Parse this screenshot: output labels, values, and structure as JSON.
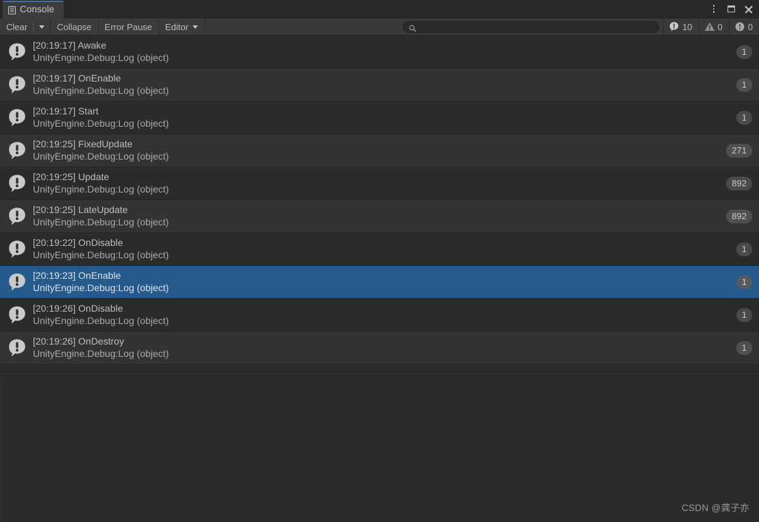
{
  "window": {
    "tab_label": "Console",
    "tab_icon": "console-icon",
    "controls": {
      "menu": "kebab-menu-icon",
      "maximize": "maximize-icon",
      "close": "close-icon"
    }
  },
  "toolbar": {
    "clear_label": "Clear",
    "clear_dropdown_icon": "chevron-down-icon",
    "collapse_label": "Collapse",
    "error_pause_label": "Error Pause",
    "editor_label": "Editor",
    "editor_dropdown_icon": "chevron-down-icon",
    "search": {
      "icon": "search-icon",
      "value": "",
      "placeholder": ""
    },
    "counters": [
      {
        "icon": "log-icon",
        "count": "10",
        "type": "log"
      },
      {
        "icon": "warning-icon",
        "count": "0",
        "type": "warning"
      },
      {
        "icon": "error-icon",
        "count": "0",
        "type": "error"
      }
    ]
  },
  "log_entries": [
    {
      "message": "[20:19:17] Awake",
      "stack": "UnityEngine.Debug:Log (object)",
      "count": "1",
      "icon": "log-icon",
      "selected": false
    },
    {
      "message": "[20:19:17] OnEnable",
      "stack": "UnityEngine.Debug:Log (object)",
      "count": "1",
      "icon": "log-icon",
      "selected": false
    },
    {
      "message": "[20:19:17] Start",
      "stack": "UnityEngine.Debug:Log (object)",
      "count": "1",
      "icon": "log-icon",
      "selected": false
    },
    {
      "message": "[20:19:25] FixedUpdate",
      "stack": "UnityEngine.Debug:Log (object)",
      "count": "271",
      "icon": "log-icon",
      "selected": false
    },
    {
      "message": "[20:19:25] Update",
      "stack": "UnityEngine.Debug:Log (object)",
      "count": "892",
      "icon": "log-icon",
      "selected": false
    },
    {
      "message": "[20:19:25] LateUpdate",
      "stack": "UnityEngine.Debug:Log (object)",
      "count": "892",
      "icon": "log-icon",
      "selected": false
    },
    {
      "message": "[20:19:22] OnDisable",
      "stack": "UnityEngine.Debug:Log (object)",
      "count": "1",
      "icon": "log-icon",
      "selected": false
    },
    {
      "message": "[20:19:23] OnEnable",
      "stack": "UnityEngine.Debug:Log (object)",
      "count": "1",
      "icon": "log-icon",
      "selected": true
    },
    {
      "message": "[20:19:26] OnDisable",
      "stack": "UnityEngine.Debug:Log (object)",
      "count": "1",
      "icon": "log-icon",
      "selected": false
    },
    {
      "message": "[20:19:26] OnDestroy",
      "stack": "UnityEngine.Debug:Log (object)",
      "count": "1",
      "icon": "log-icon",
      "selected": false
    }
  ],
  "detail": {
    "stack_trace_text": "",
    "watermark": "CSDN @龚子亦"
  },
  "colors": {
    "window_bg": "#282828",
    "toolbar_bg": "#393939",
    "row_even": "#2b2b2b",
    "row_odd": "#333333",
    "selection": "#265a8c",
    "tab_accent": "#3f6fa8",
    "text": "#bdbdbd",
    "badge": "#4a4a4a"
  }
}
